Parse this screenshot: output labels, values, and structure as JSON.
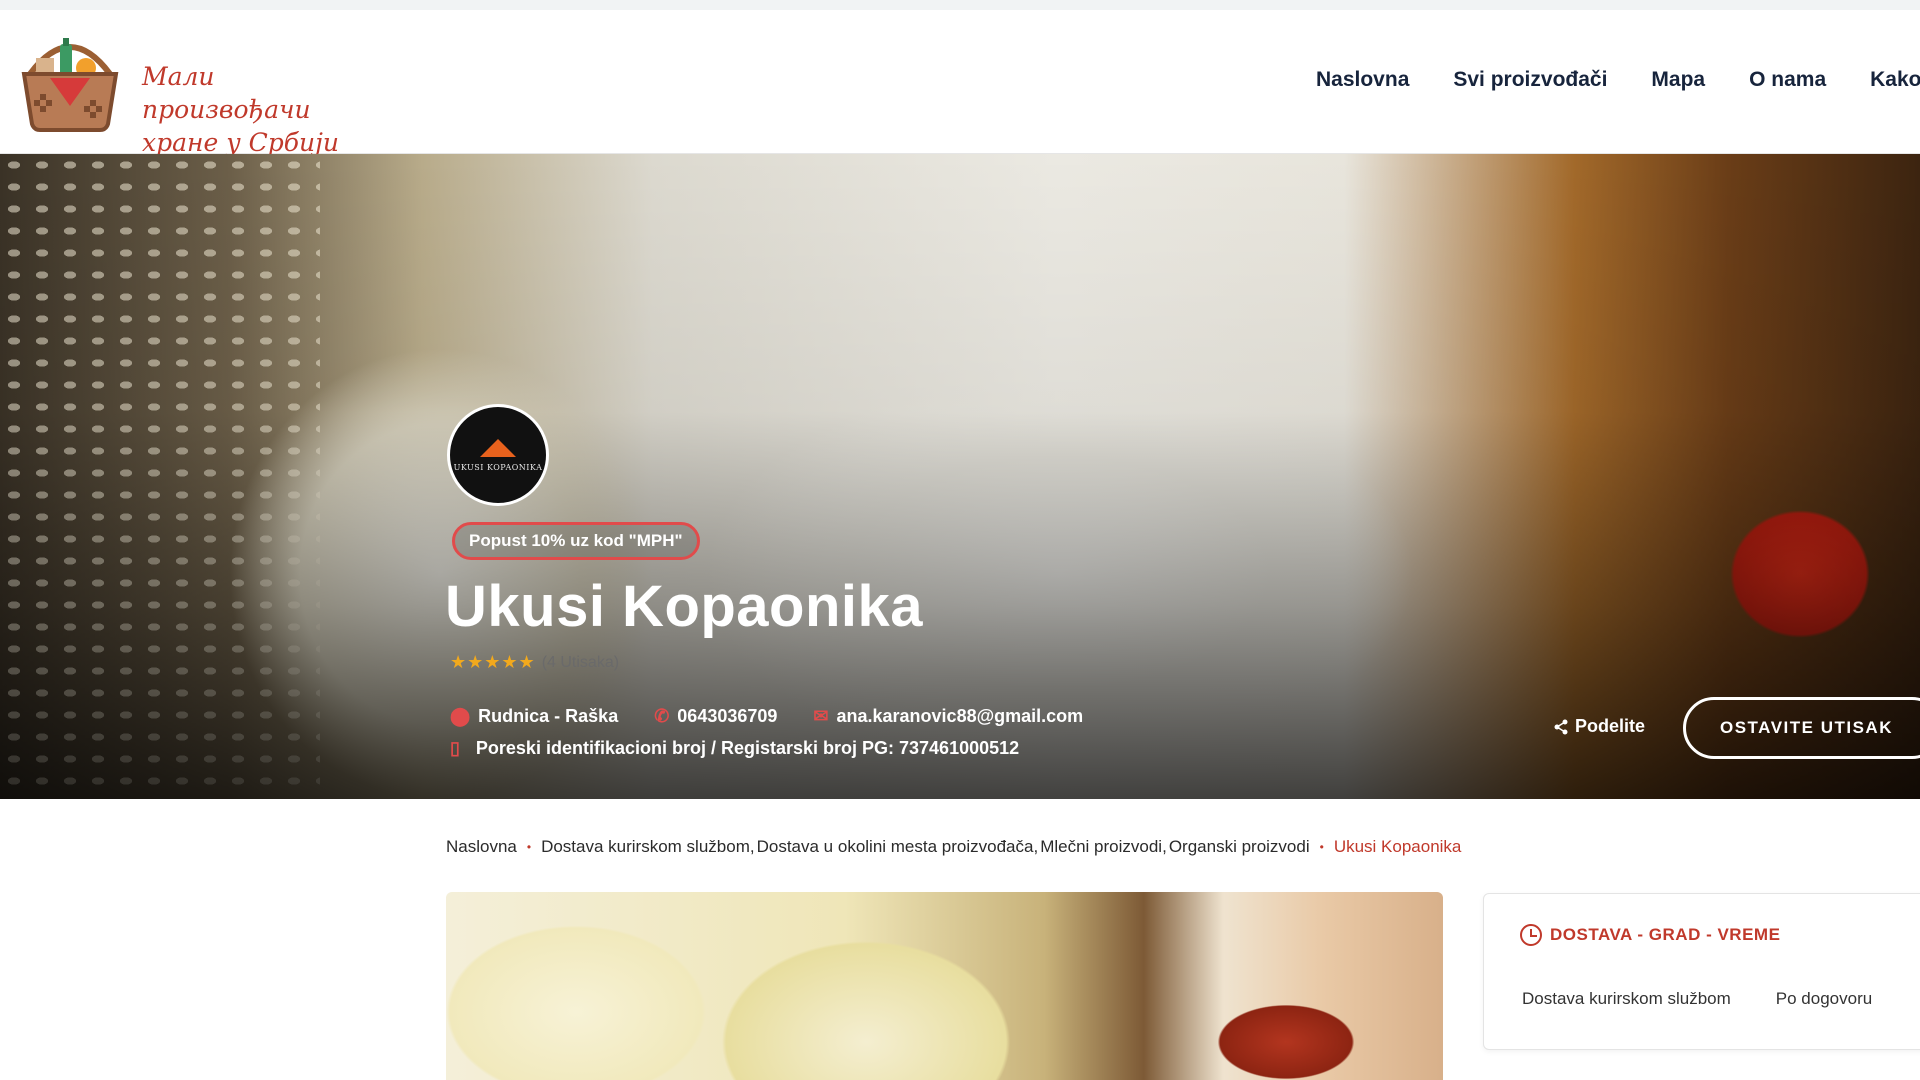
{
  "header": {
    "logo_text_line1": "Мали произвођачи",
    "logo_text_line2": "хране у Србији",
    "nav": [
      "Naslovna",
      "Svi proizvođači",
      "Mapa",
      "O nama",
      "Kako d"
    ]
  },
  "hero": {
    "avatar_caption": "UKUSI KOPAONIKA",
    "promo": "Popust 10% uz kod \"MPH\"",
    "title": "Ukusi Kopaonika",
    "stars": "★★★★★",
    "ratings_count": "(4 Utisaka)",
    "location": "Rudnica - Raška",
    "phone": "0643036709",
    "email": "ana.karanovic88@gmail.com",
    "tax_id": "Poreski identifikacioni broj / Registarski broj PG: 737461000512",
    "share_label": "Podelite",
    "review_button": "OSTAVITE UTISAK"
  },
  "breadcrumb": {
    "home": "Naslovna",
    "categories": [
      "Dostava kurirskom službom",
      "Dostava u okolini mesta proizvođača",
      "Mlečni proizvodi",
      "Organski proizvodi"
    ],
    "current": "Ukusi Kopaonika"
  },
  "side_card": {
    "heading": "DOSTAVA - GRAD - VREME",
    "values": [
      "Dostava kurirskom službom",
      "Po dogovoru"
    ]
  },
  "colors": {
    "accent_red": "#c0392b",
    "nav_text": "#17243c",
    "star_gold": "#f2a91d"
  }
}
